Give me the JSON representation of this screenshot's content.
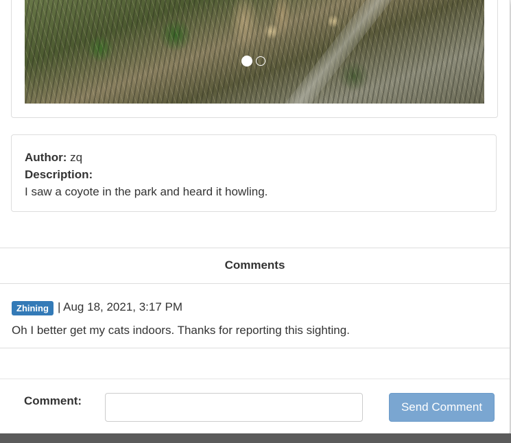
{
  "carousel": {
    "slide_count": 2,
    "active_index": 0
  },
  "info": {
    "author_label": "Author:",
    "author_value": "zq",
    "description_label": "Description:",
    "description_value": "I saw a coyote in the park and heard it howling."
  },
  "comments": {
    "header": "Comments",
    "items": [
      {
        "user": "Zhining",
        "timestamp": "| Aug 18, 2021, 3:17 PM",
        "text": "Oh I better get my cats indoors. Thanks for reporting this sighting."
      }
    ]
  },
  "form": {
    "comment_label": "Comment:",
    "comment_value": "",
    "comment_placeholder": "",
    "send_label": "Send Comment"
  },
  "colors": {
    "badge": "#337ab7",
    "send_button": "#7aa6d1"
  }
}
